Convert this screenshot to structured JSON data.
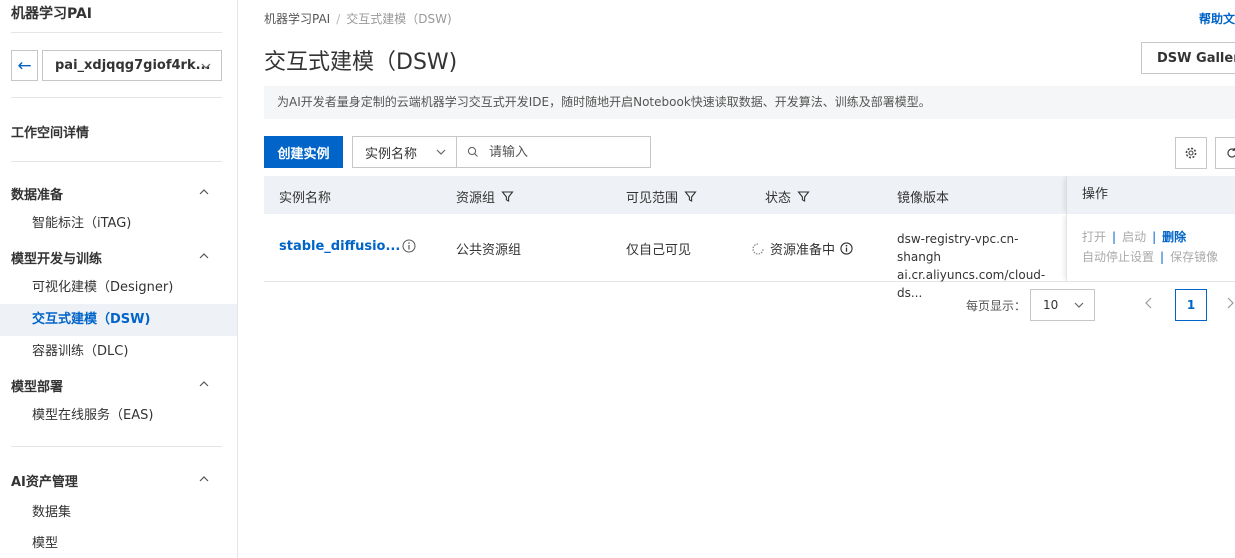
{
  "sidebar": {
    "title": "机器学习PAI",
    "workspace": "pai_xdjqqg7giof4rk...",
    "workspace_detail": "工作空间详情",
    "groups": [
      {
        "label": "数据准备",
        "items": [
          "智能标注（iTAG)"
        ]
      },
      {
        "label": "模型开发与训练",
        "items": [
          "可视化建模（Designer)",
          "交互式建模（DSW)",
          "容器训练（DLC)"
        ]
      },
      {
        "label": "模型部署",
        "items": [
          "模型在线服务（EAS)"
        ]
      },
      {
        "label": "AI资产管理",
        "items": [
          "数据集",
          "模型"
        ]
      }
    ]
  },
  "header": {
    "breadcrumb_root": "机器学习PAI",
    "breadcrumb_sep": "/",
    "breadcrumb_current": "交互式建模（DSW)",
    "help_link": "帮助文",
    "page_title": "交互式建模（DSW)",
    "gallery_button": "DSW Gallery",
    "description": "为AI开发者量身定制的云端机器学习交互式开发IDE，随时随地开启Notebook快速读取数据、开发算法、训练及部署模型。"
  },
  "toolbar": {
    "create_button": "创建实例",
    "filter_field": "实例名称",
    "search_placeholder": "请输入"
  },
  "table": {
    "columns": {
      "name": "实例名称",
      "resource_group": "资源组",
      "visibility": "可见范围",
      "status": "状态",
      "image": "镜像版本",
      "actions": "操作"
    },
    "rows": [
      {
        "name": "stable_diffusio...",
        "resource_group": "公共资源组",
        "visibility": "仅自己可见",
        "status": "资源准备中",
        "image_line1": "dsw-registry-vpc.cn-shangh",
        "image_line2": "ai.cr.aliyuncs.com/cloud-ds...",
        "actions": {
          "open": "打开",
          "start": "启动",
          "delete": "删除",
          "auto_stop": "自动停止设置",
          "save_image": "保存镜像"
        }
      }
    ]
  },
  "pagination": {
    "page_size_label": "每页显示：",
    "page_size": "10",
    "current_page": "1"
  },
  "colors": {
    "primary": "#0064c8",
    "active_bg": "#eef1f6"
  }
}
